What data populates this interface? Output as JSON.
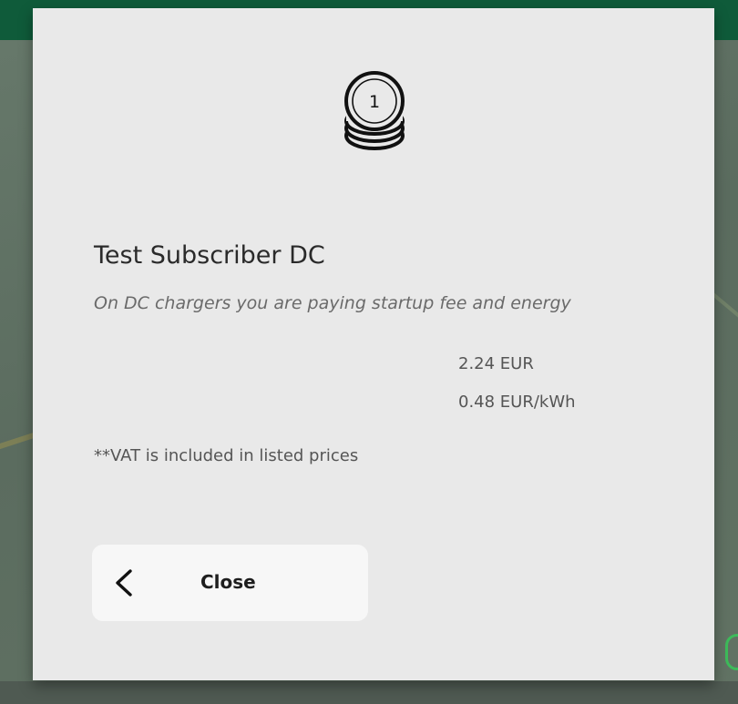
{
  "modal": {
    "coin_number": "1",
    "title": "Test Subscriber DC",
    "subtitle": "On DC chargers you are paying startup fee and energy",
    "prices": [
      {
        "value": "2.24 EUR"
      },
      {
        "value": "0.48 EUR/kWh"
      }
    ],
    "vat_note": "**VAT is included in listed prices",
    "close_button": {
      "label": "Close",
      "icon": "chevron-left-icon"
    }
  },
  "colors": {
    "topbar": "#0f5b3a",
    "modal_background": "#e9e9e9",
    "button_background": "#f7f7f7",
    "map_pin": "#3dbb5a"
  }
}
